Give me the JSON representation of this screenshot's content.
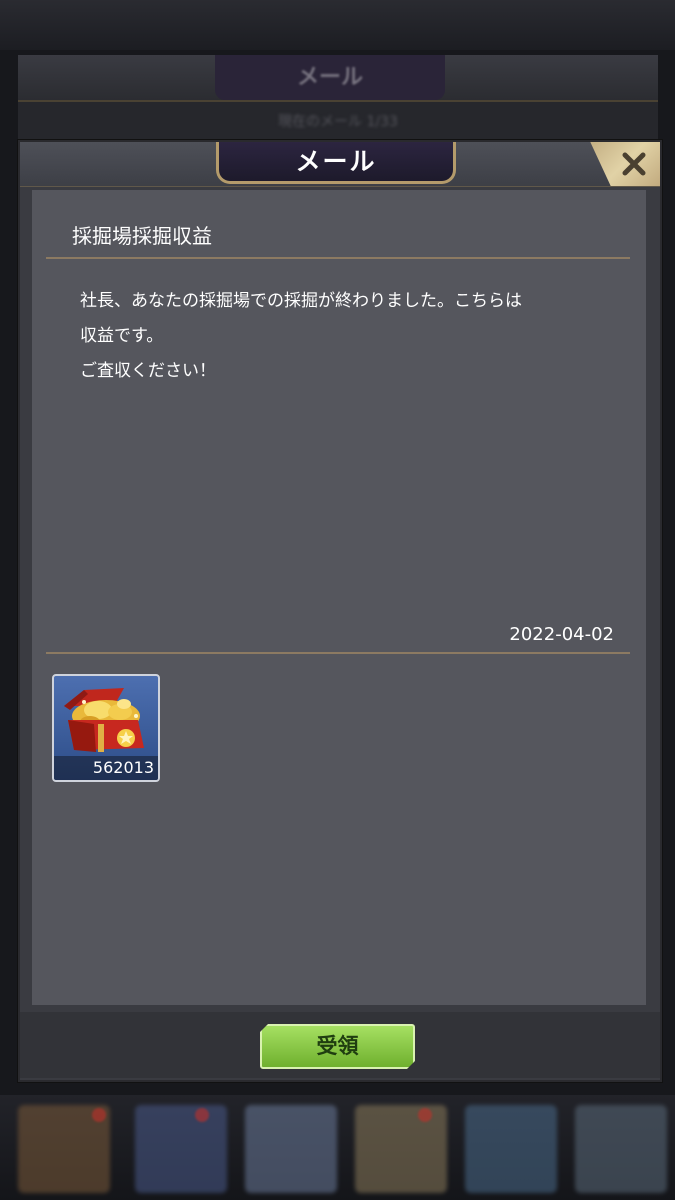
{
  "background": {
    "header_title": "メール",
    "sub_text": "現在のメール 1/33"
  },
  "modal": {
    "title": "メール",
    "close_icon": "close-x-icon",
    "subject": "採掘場採掘収益",
    "body_lines": [
      "社長、あなたの採掘場での採掘が終わりました。こちらは",
      "収益です。",
      "ご査収ください！"
    ],
    "date": "2022-04-02",
    "attachment": {
      "icon": "gold-treasure-chest-icon",
      "count": "562013"
    },
    "receive_label": "受領"
  },
  "colors": {
    "panel": "#55565d",
    "divider": "#8c7a62",
    "button_green": "#8fcd4a",
    "title_gold": "#b49b6b"
  }
}
